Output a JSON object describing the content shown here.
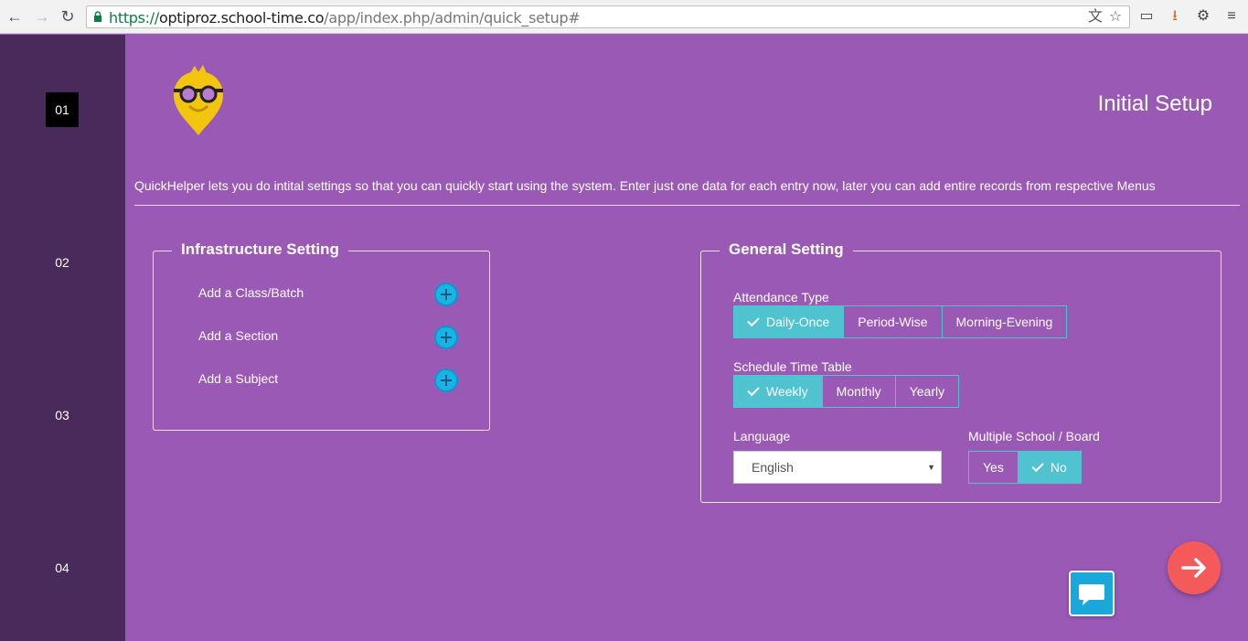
{
  "browser": {
    "url_scheme": "https://",
    "url_host": "optiproz.school-time.co",
    "url_path": "/app/index.php/admin/quick_setup#"
  },
  "steps": [
    "01",
    "02",
    "03",
    "04"
  ],
  "active_step": "01",
  "header": {
    "title": "Initial Setup",
    "intro": "QuickHelper lets you do intital settings so that you can quickly start using the system. Enter just one data for each entry now, later you can add entire records from respective Menus"
  },
  "infrastructure": {
    "legend": "Infrastructure Setting",
    "items": [
      "Add a Class/Batch",
      "Add a Section",
      "Add a Subject"
    ]
  },
  "general": {
    "legend": "General Setting",
    "attendance": {
      "label": "Attendance Type",
      "options": [
        "Daily-Once",
        "Period-Wise",
        "Morning-Evening"
      ],
      "selected": "Daily-Once"
    },
    "timetable": {
      "label": "Schedule Time Table",
      "options": [
        "Weekly",
        "Monthly",
        "Yearly"
      ],
      "selected": "Weekly"
    },
    "language": {
      "label": "Language",
      "value": "English"
    },
    "multiple_school": {
      "label": "Multiple School / Board",
      "options": [
        "Yes",
        "No"
      ],
      "selected": "No"
    }
  },
  "colors": {
    "background": "#9b59b6",
    "rail": "#4a2a5a",
    "accent": "#4fc3cf",
    "next": "#f55a5a",
    "chat": "#1aa7d9"
  }
}
